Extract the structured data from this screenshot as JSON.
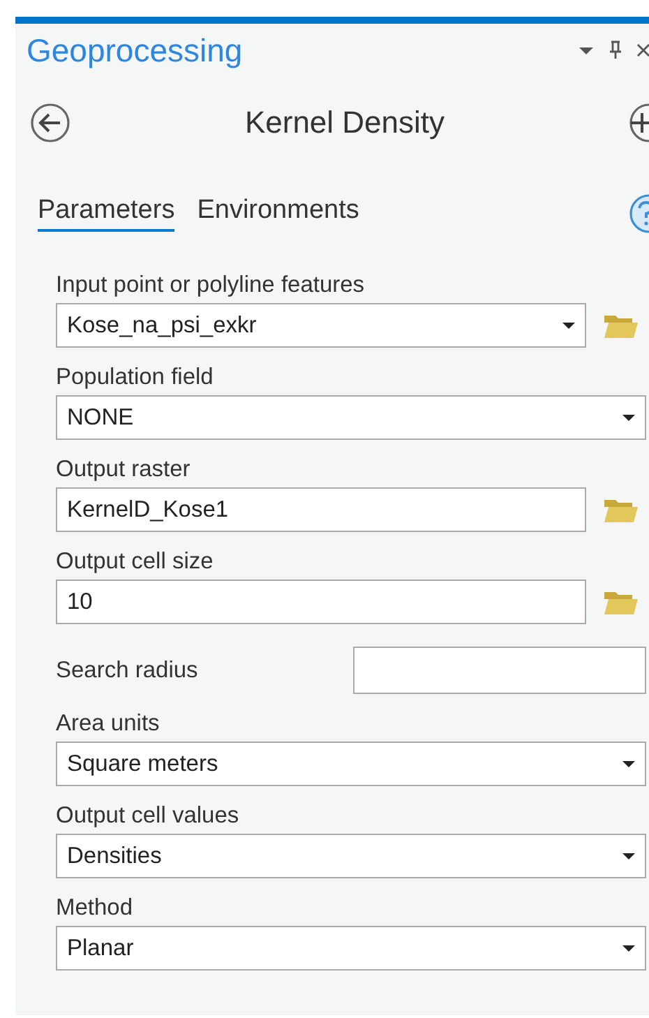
{
  "pane": {
    "title": "Geoprocessing"
  },
  "tool": {
    "title": "Kernel Density"
  },
  "tabs": [
    {
      "label": "Parameters",
      "selected": true
    },
    {
      "label": "Environments",
      "selected": false
    }
  ],
  "parameters": [
    {
      "kind": "dropdown",
      "label": "Input point or polyline features",
      "value": "Kose_na_psi_exkr",
      "browse": true
    },
    {
      "kind": "dropdown",
      "label": "Population field",
      "value": "NONE",
      "browse": false
    },
    {
      "kind": "text",
      "label": "Output raster",
      "value": "KernelD_Kose1",
      "browse": true
    },
    {
      "kind": "text",
      "label": "Output cell size",
      "value": "10",
      "browse": true
    },
    {
      "kind": "inline",
      "label": "Search radius",
      "browse": false
    },
    {
      "kind": "dropdown",
      "label": "Area units",
      "value": "Square meters",
      "browse": false
    },
    {
      "kind": "dropdown",
      "label": "Output cell values",
      "value": "Densities",
      "browse": false
    },
    {
      "kind": "dropdown",
      "label": "Method",
      "value": "Planar",
      "browse": false
    }
  ]
}
